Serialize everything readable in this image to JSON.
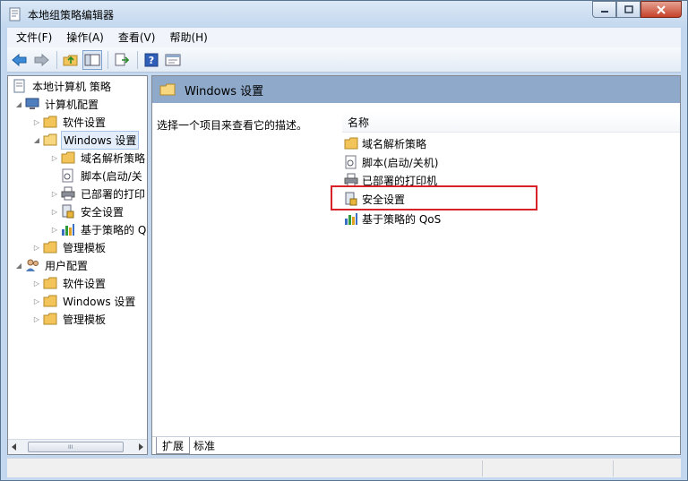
{
  "window": {
    "title": "本地组策略编辑器"
  },
  "menubar": [
    {
      "label": "文件(F)"
    },
    {
      "label": "操作(A)"
    },
    {
      "label": "查看(V)"
    },
    {
      "label": "帮助(H)"
    }
  ],
  "toolbar": {
    "icons": [
      "back-arrow-icon",
      "forward-arrow-icon",
      "up-folder-icon",
      "show-hide-tree-icon",
      "export-list-icon",
      "help-icon",
      "properties-icon"
    ]
  },
  "tree": {
    "root": "本地计算机 策略",
    "computer_config": "计算机配置",
    "software_settings": "软件设置",
    "windows_settings": "Windows 设置",
    "dns_policy": "域名解析策略",
    "scripts": "脚本(启动/关",
    "deployed_printers": "已部署的打印",
    "security_settings": "安全设置",
    "qos": "基于策略的 Q",
    "admin_templates": "管理模板",
    "user_config": "用户配置",
    "user_software_settings": "软件设置",
    "user_windows_settings": "Windows 设置",
    "user_admin_templates": "管理模板",
    "scroll_grip": "III"
  },
  "rightpane": {
    "header_title": "Windows 设置",
    "description": "选择一个项目来查看它的描述。",
    "column_name": "名称",
    "items": [
      {
        "label": "域名解析策略"
      },
      {
        "label": "脚本(启动/关机)"
      },
      {
        "label": "已部署的打印机"
      },
      {
        "label": "安全设置"
      },
      {
        "label": "基于策略的 QoS"
      }
    ]
  },
  "tabs": {
    "extended": "扩展",
    "standard": "标准"
  },
  "colors": {
    "highlight": "#d8222a",
    "header_bg": "#8ea9c9",
    "folder": "#f2c45a"
  }
}
